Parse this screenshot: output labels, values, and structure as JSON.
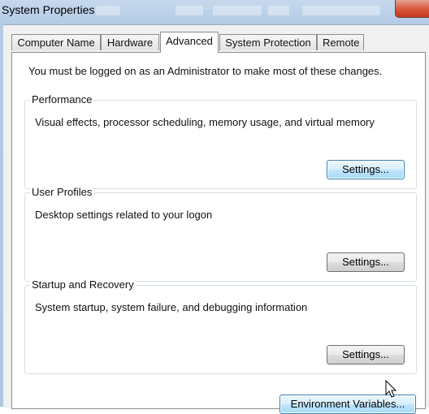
{
  "window": {
    "title": "System Properties"
  },
  "tabs": [
    {
      "label": "Computer Name"
    },
    {
      "label": "Hardware"
    },
    {
      "label": "Advanced",
      "active": true
    },
    {
      "label": "System Protection"
    },
    {
      "label": "Remote"
    }
  ],
  "advanced": {
    "notice": "You must be logged on as an Administrator to make most of these changes.",
    "performance": {
      "title": "Performance",
      "description": "Visual effects, processor scheduling, memory usage, and virtual memory",
      "button": "Settings..."
    },
    "user_profiles": {
      "title": "User Profiles",
      "description": "Desktop settings related to your logon",
      "button": "Settings..."
    },
    "startup_recovery": {
      "title": "Startup and Recovery",
      "description": "System startup, system failure, and debugging information",
      "button": "Settings..."
    },
    "env_button": "Environment Variables..."
  },
  "colors": {
    "title_glass": "#b4cbe6",
    "close_button": "#d8553c",
    "focused_button": "#bee6fd"
  },
  "icons": [
    "close-icon",
    "mouse-pointer-icon"
  ]
}
